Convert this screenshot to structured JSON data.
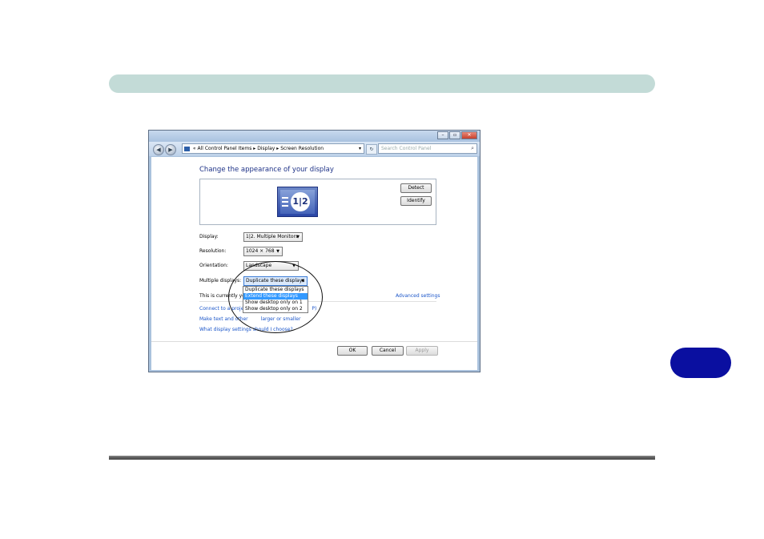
{
  "window": {
    "address": {
      "prefix": "«",
      "crumbs": [
        "All Control Panel Items",
        "Display",
        "Screen Resolution"
      ],
      "separator": "▸"
    },
    "search_placeholder": "Search Control Panel",
    "controls": {
      "minimize": "–",
      "maximize": "▫",
      "close": "✕"
    }
  },
  "main": {
    "heading": "Change the appearance of your display",
    "monitor_label": "1|2",
    "detect_label": "Detect",
    "identify_label": "Identify",
    "display": {
      "label": "Display:",
      "value": "1|2. Multiple Monitors"
    },
    "resolution": {
      "label": "Resolution:",
      "value": "1024 × 768"
    },
    "orientation": {
      "label": "Orientation:",
      "value": "Landscape"
    },
    "multiple_displays": {
      "label": "Multiple displays:",
      "value": "Duplicate these displays",
      "options": [
        "Duplicate these displays",
        "Extend these displays",
        "Show desktop only on 1",
        "Show desktop only on 2"
      ],
      "highlighted_index": 1
    },
    "info_text": "This is currently you",
    "advanced_link": "Advanced settings",
    "links": {
      "connect_prefix": "Connect to a proje",
      "connect_suffix": "P)",
      "text_size_prefix": "Make text and other",
      "text_size_suffix": "larger or smaller",
      "help": "What display settings should I choose?"
    },
    "ok_label": "OK",
    "cancel_label": "Cancel",
    "apply_label": "Apply"
  },
  "colors": {
    "top_band": "#c3dbd7",
    "side_tab": "#0a0fa0",
    "link": "#1a55c9",
    "heading": "#1e3287",
    "selection": "#3399ff"
  }
}
